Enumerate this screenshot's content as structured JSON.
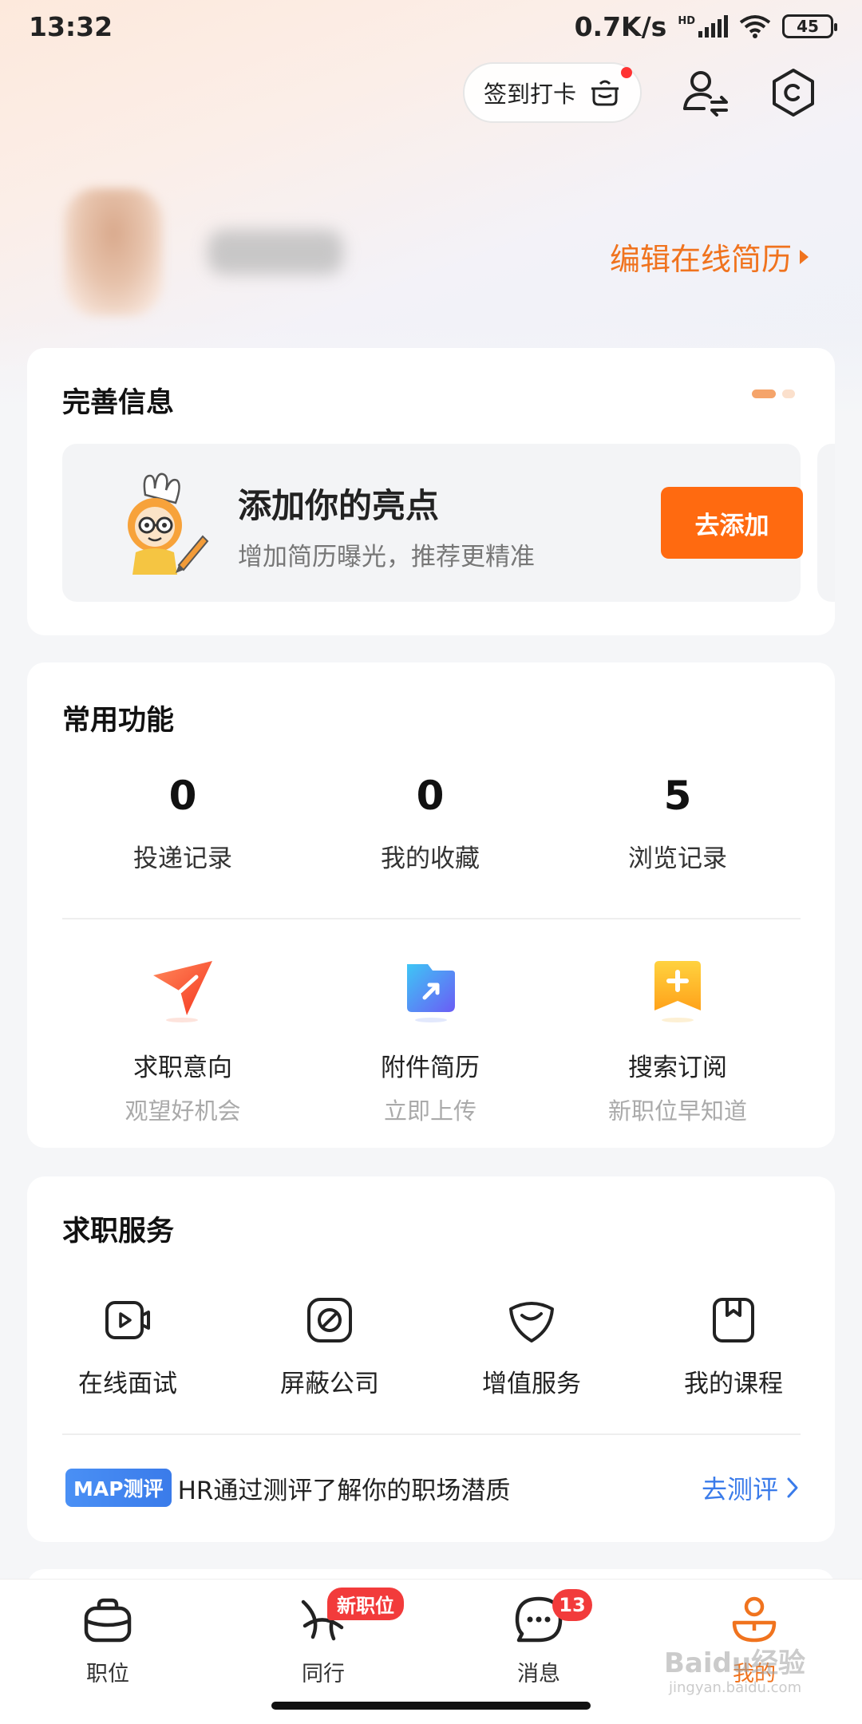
{
  "status_bar": {
    "time": "13:32",
    "network": "0.7K/s",
    "hd": "HD",
    "battery": "45"
  },
  "header": {
    "checkin_label": "签到打卡",
    "edit_resume": "编辑在线简历"
  },
  "complete_info": {
    "title": "完善信息",
    "highlight_title": "添加你的亮点",
    "highlight_sub": "增加简历曝光，推荐更精准",
    "add_button": "去添加"
  },
  "common_functions": {
    "title": "常用功能",
    "stats": [
      {
        "value": "0",
        "label": "投递记录"
      },
      {
        "value": "0",
        "label": "我的收藏"
      },
      {
        "value": "5",
        "label": "浏览记录"
      }
    ],
    "features": [
      {
        "label": "求职意向",
        "sub": "观望好机会",
        "icon": "send-arrow-icon"
      },
      {
        "label": "附件简历",
        "sub": "立即上传",
        "icon": "attachment-icon"
      },
      {
        "label": "搜索订阅",
        "sub": "新职位早知道",
        "icon": "subscribe-icon"
      }
    ]
  },
  "job_services": {
    "title": "求职服务",
    "items": [
      {
        "label": "在线面试",
        "icon": "video-interview-icon"
      },
      {
        "label": "屏蔽公司",
        "icon": "block-icon"
      },
      {
        "label": "增值服务",
        "icon": "value-added-icon"
      },
      {
        "label": "我的课程",
        "icon": "course-icon"
      }
    ],
    "map_badge": "MAP测评",
    "map_text": "HR通过测评了解你的职场潜质",
    "map_link": "去测评"
  },
  "tabbar": {
    "tabs": [
      {
        "label": "职位",
        "icon": "briefcase-icon"
      },
      {
        "label": "同行",
        "icon": "peers-icon",
        "badge": "新职位"
      },
      {
        "label": "消息",
        "icon": "message-icon",
        "badge": "13"
      },
      {
        "label": "我的",
        "icon": "profile-icon"
      }
    ]
  },
  "watermark": {
    "main": "Baidu经验",
    "sub": "jingyan.baidu.com"
  },
  "colors": {
    "accent": "#f0731e",
    "button": "#ff6a10",
    "link": "#3a7bea",
    "badge": "#f23b3b"
  }
}
